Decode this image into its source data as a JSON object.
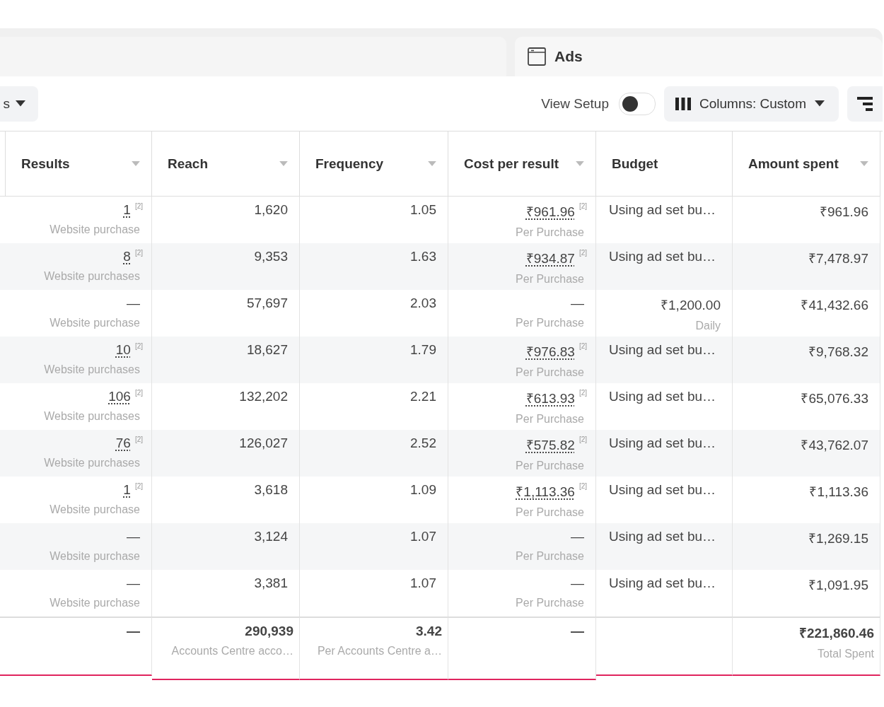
{
  "tab": {
    "label": "Ads"
  },
  "toolbar": {
    "left_button": "s",
    "view_setup": {
      "label": "View Setup",
      "on": false
    },
    "columns_button": "Columns: Custom"
  },
  "table": {
    "columns": [
      {
        "label": "Results",
        "sortable": true
      },
      {
        "label": "Reach",
        "sortable": true
      },
      {
        "label": "Frequency",
        "sortable": true
      },
      {
        "label": "Cost per result",
        "sortable": true
      },
      {
        "label": "Budget",
        "sortable": false
      },
      {
        "label": "Amount spent",
        "sortable": true
      }
    ],
    "rows": [
      {
        "results": "1",
        "results_linked": true,
        "results_note": "[2]",
        "results_label": "Website purchase",
        "reach": "1,620",
        "frequency": "1.05",
        "cost": "₹961.96",
        "cost_linked": true,
        "cost_note": "[2]",
        "cost_label": "Per Purchase",
        "budget": "Using ad set bu…",
        "amount": "₹961.96"
      },
      {
        "results": "8",
        "results_linked": true,
        "results_note": "[2]",
        "results_label": "Website purchases",
        "reach": "9,353",
        "frequency": "1.63",
        "cost": "₹934.87",
        "cost_linked": true,
        "cost_note": "[2]",
        "cost_label": "Per Purchase",
        "budget": "Using ad set bu…",
        "amount": "₹7,478.97"
      },
      {
        "results": "—",
        "results_linked": false,
        "results_label": "Website purchase",
        "reach": "57,697",
        "frequency": "2.03",
        "cost": "—",
        "cost_linked": false,
        "cost_label": "Per Purchase",
        "budget": "₹1,200.00",
        "budget_label": "Daily",
        "amount": "₹41,432.66"
      },
      {
        "results": "10",
        "results_linked": true,
        "results_note": "[2]",
        "results_label": "Website purchases",
        "reach": "18,627",
        "frequency": "1.79",
        "cost": "₹976.83",
        "cost_linked": true,
        "cost_note": "[2]",
        "cost_label": "Per Purchase",
        "budget": "Using ad set bu…",
        "amount": "₹9,768.32"
      },
      {
        "results": "106",
        "results_linked": true,
        "results_note": "[2]",
        "results_label": "Website purchases",
        "reach": "132,202",
        "frequency": "2.21",
        "cost": "₹613.93",
        "cost_linked": true,
        "cost_note": "[2]",
        "cost_label": "Per Purchase",
        "budget": "Using ad set bu…",
        "amount": "₹65,076.33"
      },
      {
        "results": "76",
        "results_linked": true,
        "results_note": "[2]",
        "results_label": "Website purchases",
        "reach": "126,027",
        "frequency": "2.52",
        "cost": "₹575.82",
        "cost_linked": true,
        "cost_note": "[2]",
        "cost_label": "Per Purchase",
        "budget": "Using ad set bu…",
        "amount": "₹43,762.07"
      },
      {
        "results": "1",
        "results_linked": true,
        "results_note": "[2]",
        "results_label": "Website purchase",
        "reach": "3,618",
        "frequency": "1.09",
        "cost": "₹1,113.36",
        "cost_linked": true,
        "cost_note": "[2]",
        "cost_label": "Per Purchase",
        "budget": "Using ad set bu…",
        "amount": "₹1,113.36"
      },
      {
        "results": "—",
        "results_linked": false,
        "results_label": "Website purchase",
        "reach": "3,124",
        "frequency": "1.07",
        "cost": "—",
        "cost_linked": false,
        "cost_label": "Per Purchase",
        "budget": "Using ad set bu…",
        "amount": "₹1,269.15"
      },
      {
        "results": "—",
        "results_linked": false,
        "results_label": "Website purchase",
        "reach": "3,381",
        "frequency": "1.07",
        "cost": "—",
        "cost_linked": false,
        "cost_label": "Per Purchase",
        "budget": "Using ad set bu…",
        "amount": "₹1,091.95"
      }
    ],
    "totals": {
      "results": "—",
      "reach": "290,939",
      "reach_label": "Accounts Centre acco…",
      "frequency": "3.42",
      "frequency_label": "Per Accounts Centre a…",
      "cost": "—",
      "amount": "₹221,860.46",
      "amount_label": "Total Spent"
    }
  }
}
